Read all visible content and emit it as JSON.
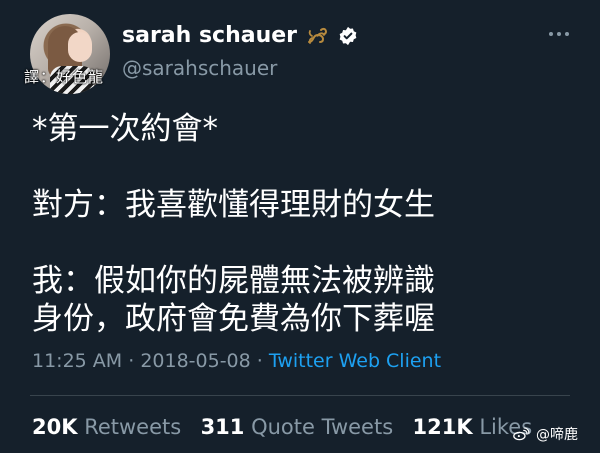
{
  "profile": {
    "display_name": "sarah schauer",
    "handle": "@sarahschauer",
    "avatar_watermark": "譯：好色龍"
  },
  "tweet": {
    "lines": [
      "*第一次約會*",
      "",
      "對方：我喜歡懂得理財的女生",
      "",
      "我：假如你的屍體無法被辨識",
      "身份，政府會免費為你下葬喔"
    ]
  },
  "meta": {
    "time": "11:25 AM",
    "separator1": " · ",
    "date": "2018-05-08",
    "separator2": " · ",
    "client": "Twitter Web Client"
  },
  "stats": {
    "retweets_count": "20K",
    "retweets_label": "Retweets",
    "quote_count": "311",
    "quote_label": "Quote Tweets",
    "likes_count": "121K",
    "likes_label": "Likes"
  },
  "watermark": {
    "text": "@啼鹿"
  },
  "icons": {
    "scorpion": "scorpion-icon",
    "verified": "verified-icon",
    "more": "more-icon",
    "weibo": "weibo-icon"
  },
  "colors": {
    "background": "#15202b",
    "text": "#ffffff",
    "secondary": "#8899a6",
    "link": "#1da1f2"
  }
}
